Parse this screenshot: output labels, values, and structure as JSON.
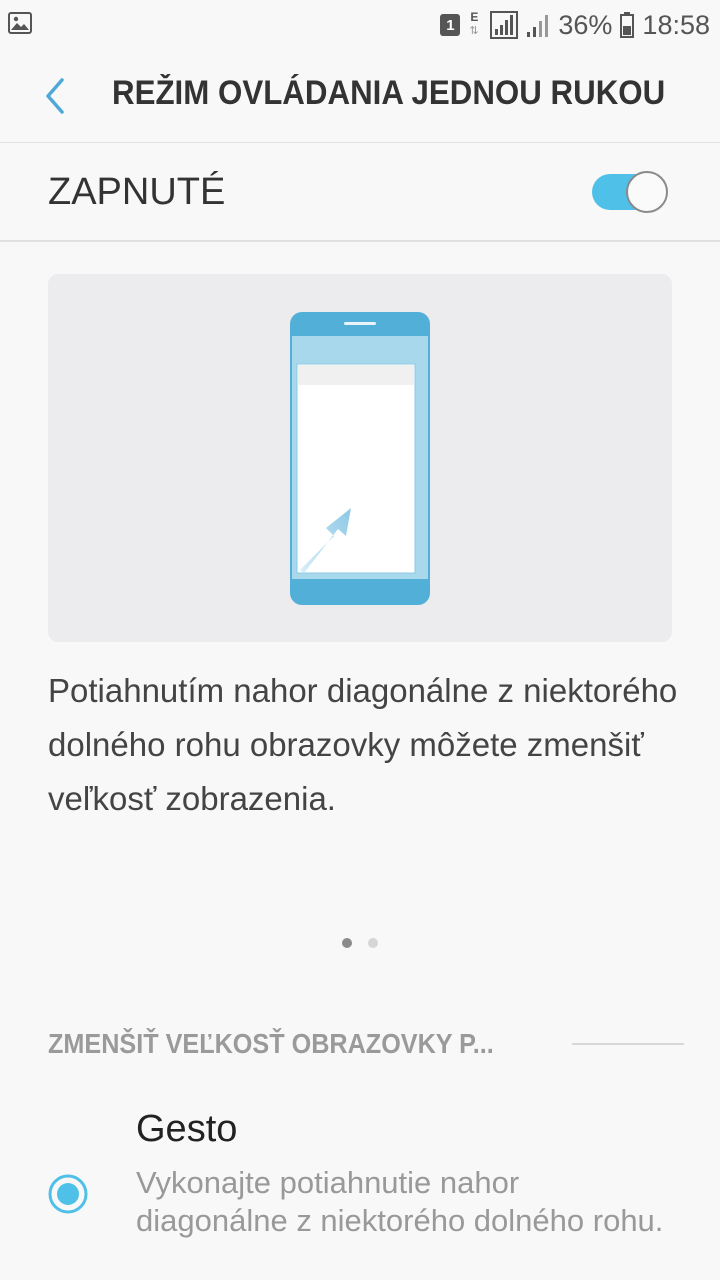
{
  "statusbar": {
    "sim_badge": "1",
    "network_type": "E",
    "battery": "36%",
    "time": "18:58"
  },
  "header": {
    "title": "REŽIM OVLÁDANIA JEDNOU RUKOU"
  },
  "toggle": {
    "label": "ZAPNUTÉ",
    "state": "on"
  },
  "description": "Potiahnutím nahor diagonálne z niektorého dolného rohu obrazovky môžete zmenšiť veľkosť zobrazenia.",
  "pager": {
    "page_count": 2,
    "active_page": 1
  },
  "section": {
    "title": "ZMENŠIŤ VEĽKOSŤ OBRAZOVKY P..."
  },
  "option": {
    "title": "Gesto",
    "subtitle": "Vykonajte potiahnutie nahor diagonálne z niektorého dolného rohu.",
    "selected": true
  },
  "colors": {
    "accent": "#4fc0e8",
    "phone_blue": "#52b0d8",
    "phone_light": "#a8d8ec"
  }
}
